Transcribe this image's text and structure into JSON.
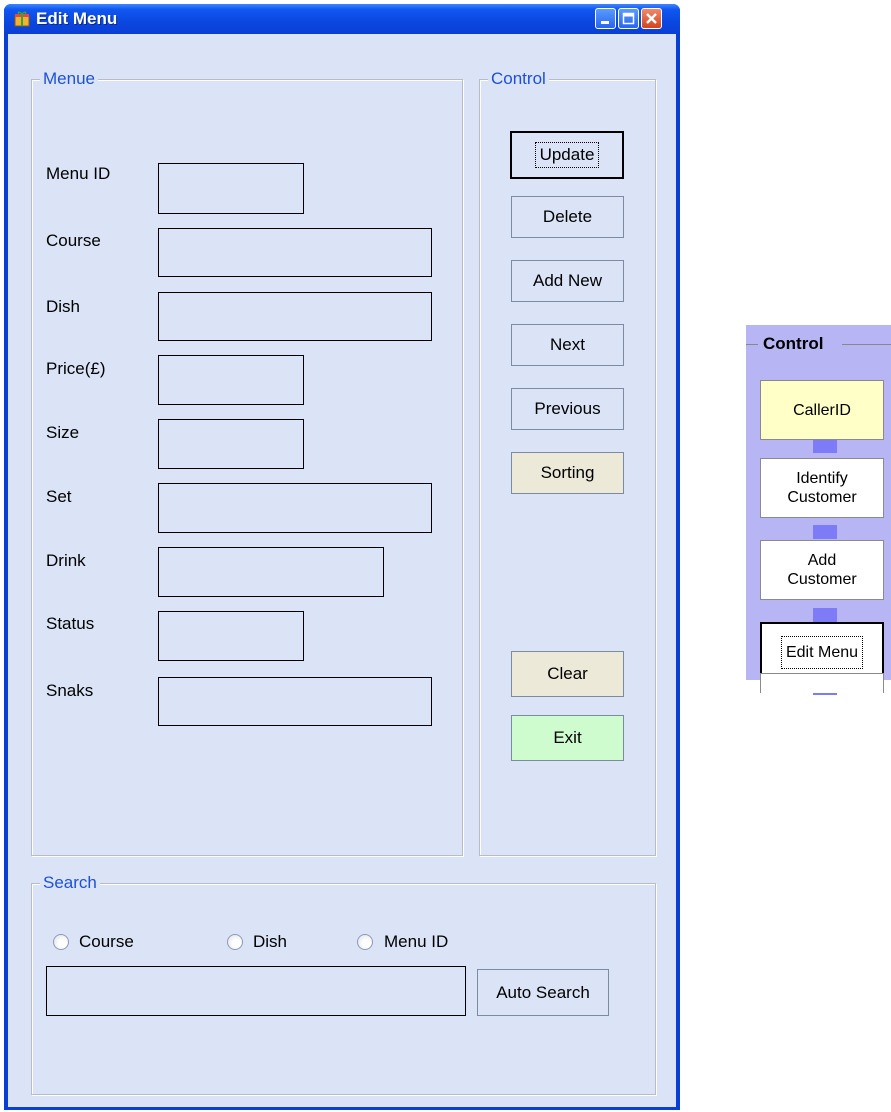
{
  "window": {
    "title": "Edit Menu"
  },
  "menu_group": {
    "legend": "Menue",
    "fields": [
      {
        "label": "Menu ID",
        "value": ""
      },
      {
        "label": "Course",
        "value": ""
      },
      {
        "label": "Dish",
        "value": ""
      },
      {
        "label": "Price(£)",
        "value": ""
      },
      {
        "label": "Size",
        "value": ""
      },
      {
        "label": "Set",
        "value": ""
      },
      {
        "label": "Drink",
        "value": ""
      },
      {
        "label": "Status",
        "value": ""
      },
      {
        "label": "Snaks",
        "value": ""
      }
    ]
  },
  "control_group": {
    "legend": "Control",
    "buttons": [
      "Update",
      "Delete",
      "Add New",
      "Next",
      "Previous",
      "Sorting",
      "Clear",
      "Exit"
    ]
  },
  "search_group": {
    "legend": "Search",
    "radios": [
      "Course",
      "Dish",
      "Menu ID"
    ],
    "query": "",
    "auto_search_label": "Auto Search"
  },
  "side_panel": {
    "title": "Control",
    "buttons": [
      "CallerID",
      "Identify\nCustomer",
      "Add\nCustomer",
      "Edit Menu"
    ]
  },
  "colors": {
    "titlebar": "#0a47e0",
    "client_bg": "#dae4f6",
    "legend_text": "#1e50d8",
    "exit_button": "#cffccf",
    "beige_button": "#ece9d8",
    "side_panel": "#b7b5f3",
    "caller_id_button": "#ffffc8"
  }
}
